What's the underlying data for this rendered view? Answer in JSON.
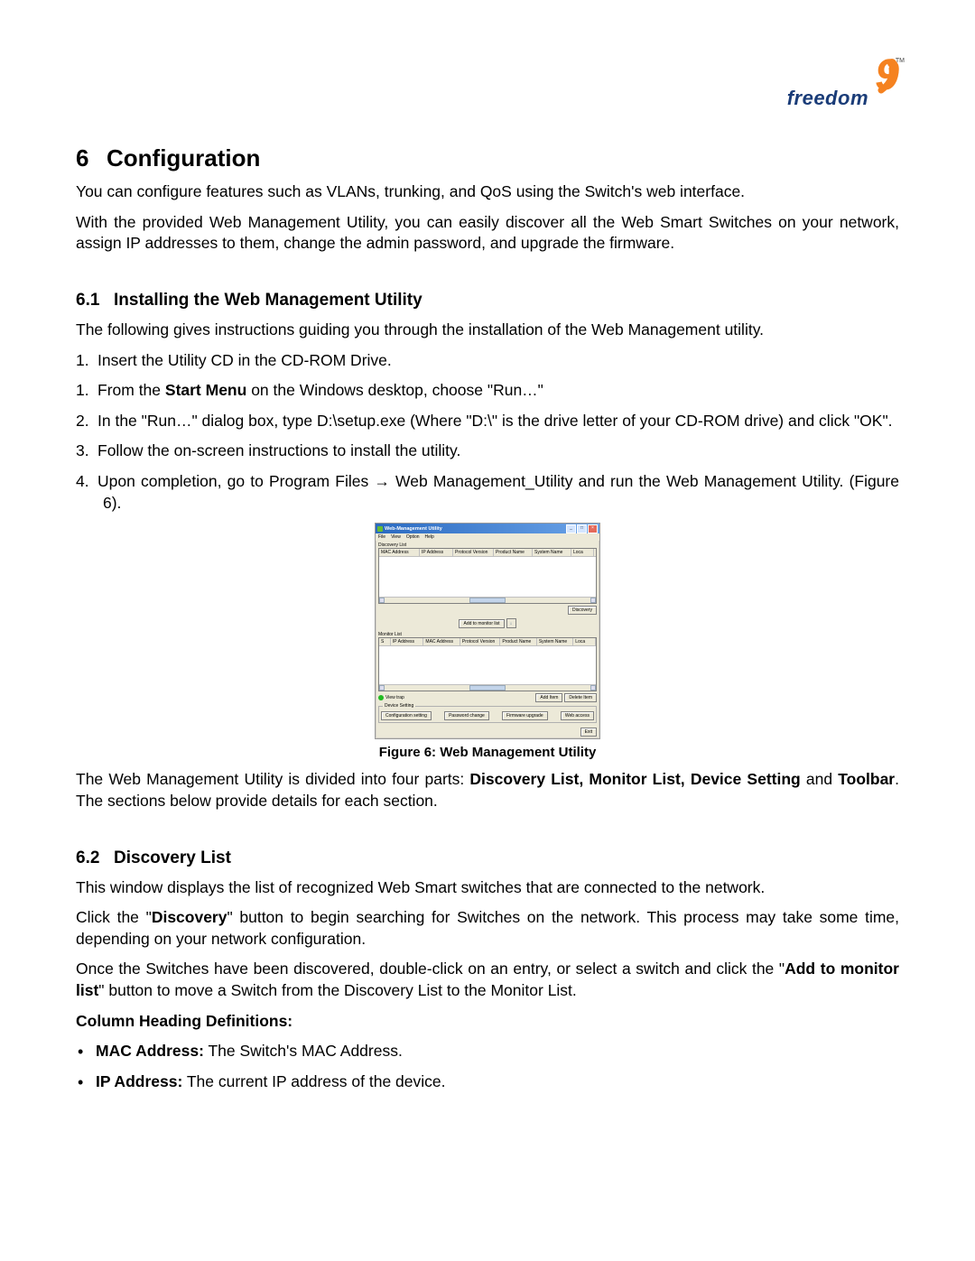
{
  "logo": {
    "brand": "freedom",
    "digit": "9",
    "tm": "TM"
  },
  "section": {
    "num": "6",
    "title": "Configuration"
  },
  "intro": {
    "p1": "You can configure features such as VLANs, trunking, and QoS using the Switch's web interface.",
    "p2": "With the provided Web Management Utility, you can easily discover all the Web Smart Switches on your network, assign IP addresses to them, change the admin password, and upgrade the firmware."
  },
  "s61": {
    "num": "6.1",
    "title": "Installing the Web Management Utility",
    "lead": "The following gives instructions guiding you through the installation of the Web Management utility.",
    "steps": [
      {
        "n": "1.",
        "html": "Insert the Utility CD in the CD-ROM Drive."
      },
      {
        "n": "1.",
        "html": "From the <b>Start Menu</b> on the Windows desktop, choose \"Run…\""
      },
      {
        "n": "2.",
        "html": "In the \"Run…\" dialog box, type D:\\setup.exe (Where \"D:\\\" is the drive letter of your CD-ROM drive) and click \"OK\"."
      },
      {
        "n": "3.",
        "html": "Follow the on-screen instructions to install the utility."
      },
      {
        "n": "4.",
        "html": "Upon completion, go to Program Files → Web Management_Utility and run the Web Management Utility. (Figure 6)."
      }
    ]
  },
  "figure": {
    "caption": "Figure 6: Web Management Utility",
    "window_title": "Web-Management Utility",
    "menus": [
      "File",
      "View",
      "Option",
      "Help"
    ],
    "discovery_label": "Discovery List",
    "discovery_cols": [
      "MAC Address",
      "IP Address",
      "Protocol Version",
      "Product Name",
      "System Name",
      "Loca"
    ],
    "discovery_btn": "Discovery",
    "add_btn": "Add to monitor list",
    "monitor_label": "Monitor List",
    "monitor_cols": [
      "S",
      "IP Address",
      "MAC Address",
      "Protocol Version",
      "Product Name",
      "System Name",
      "Loca"
    ],
    "view_trap": "View trap",
    "add_item": "Add Item",
    "delete_item": "Delete Item",
    "device_setting": "Device Setting",
    "config_setting": "Configuration setting",
    "password_change": "Password change",
    "firmware_upgrade": "Firmware upgrade",
    "web_access": "Web access",
    "exit": "Exit"
  },
  "after_figure": {
    "p1_pre": "The Web Management Utility is divided into four parts: ",
    "p1_bold": "Discovery List, Monitor List, Device Setting",
    "p1_mid": " and ",
    "p1_bold2": "Toolbar",
    "p1_post": ".  The sections below provide details for each section."
  },
  "s62": {
    "num": "6.2",
    "title": "Discovery List",
    "p1": "This window displays the list of recognized Web Smart switches that are connected to the network.",
    "p2_pre": "Click the \"",
    "p2_bold": "Discovery",
    "p2_post": "\" button to begin searching for Switches on the network.  This process may take some time, depending on your network configuration.",
    "p3_pre": "Once the Switches have been discovered, double-click on an entry, or select a switch and click the \"",
    "p3_bold": "Add to monitor list",
    "p3_post": "\" button to move a Switch from the Discovery List to the Monitor List.",
    "coldef_heading": "Column Heading Definitions:",
    "bullets": [
      {
        "b": "MAC Address:",
        "t": " The Switch's MAC Address."
      },
      {
        "b": "IP Address:",
        "t": " The current IP address of the device."
      }
    ]
  }
}
